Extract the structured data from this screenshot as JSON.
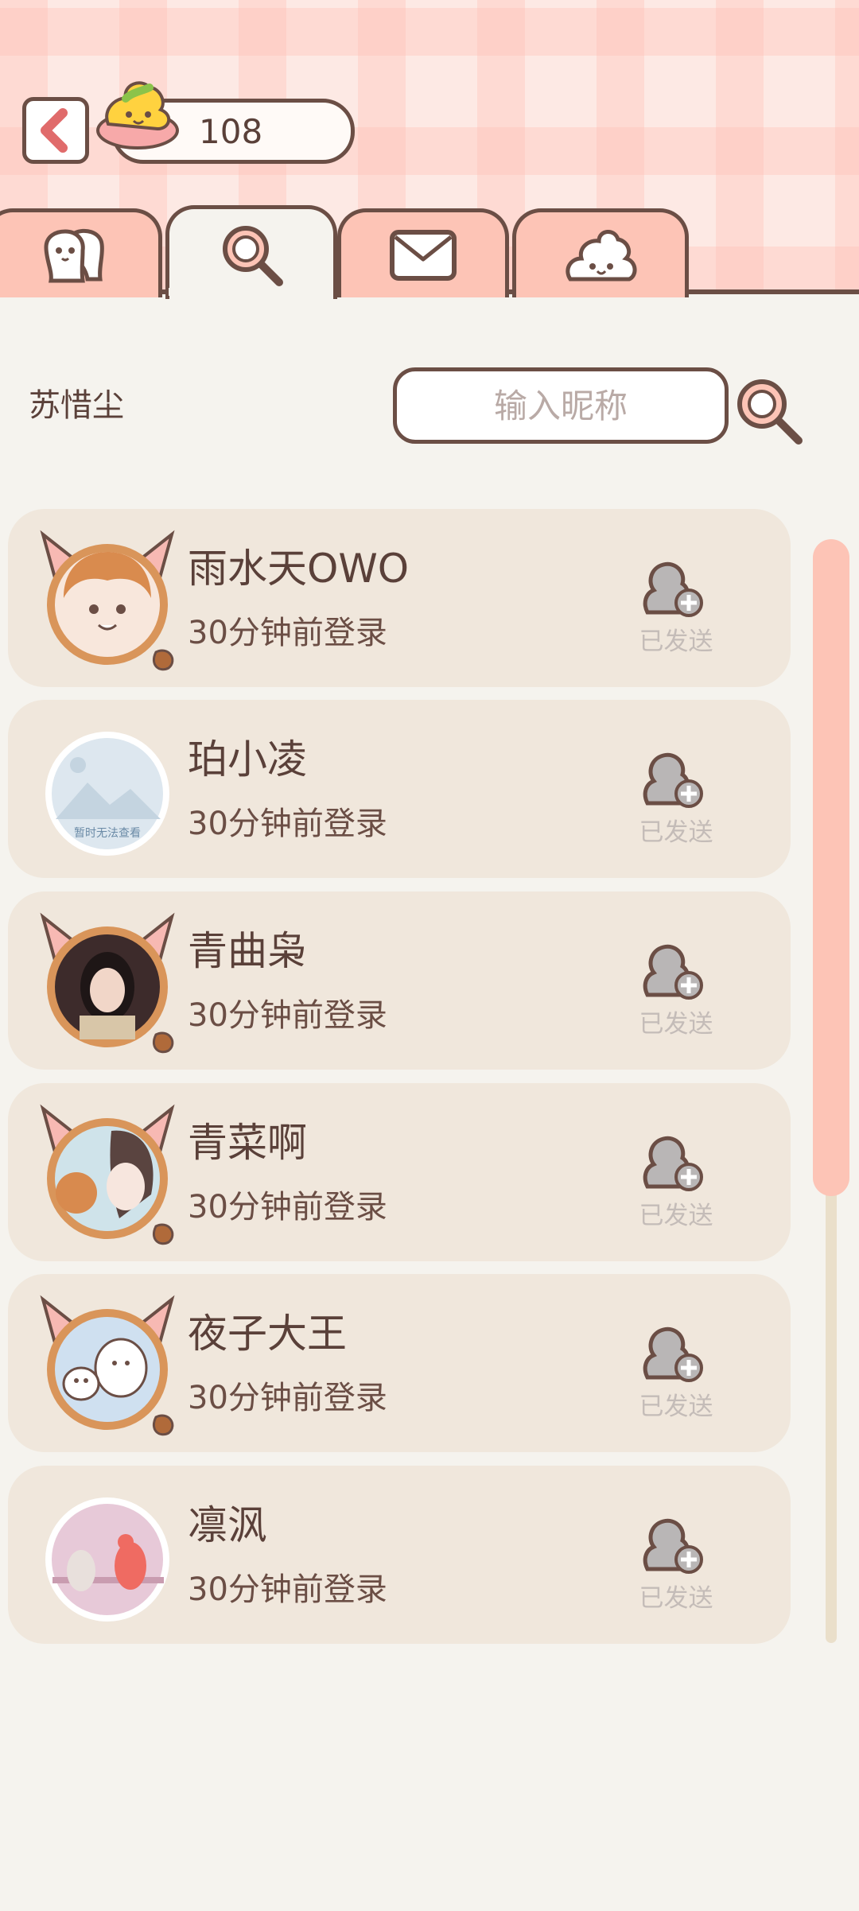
{
  "header": {
    "coin_count": "108",
    "tabs": [
      {
        "icon": "friends-icon",
        "active": false
      },
      {
        "icon": "search-icon",
        "active": true
      },
      {
        "icon": "mail-icon",
        "active": false
      },
      {
        "icon": "poop-icon",
        "active": false
      }
    ]
  },
  "search": {
    "my_name": "苏惜尘",
    "placeholder": "输入昵称"
  },
  "users": [
    {
      "name": "雨水天OWO",
      "status": "30分钟前登录",
      "action": "已发送",
      "avatar_frame": "cat-ears"
    },
    {
      "name": "珀小凌",
      "status": "30分钟前登录",
      "action": "已发送",
      "avatar_frame": "plain",
      "avatar_caption": "暂时无法查看"
    },
    {
      "name": "青曲枭",
      "status": "30分钟前登录",
      "action": "已发送",
      "avatar_frame": "cat-ears"
    },
    {
      "name": "青菜啊",
      "status": "30分钟前登录",
      "action": "已发送",
      "avatar_frame": "cat-ears"
    },
    {
      "name": "夜子大王",
      "status": "30分钟前登录",
      "action": "已发送",
      "avatar_frame": "cat-ears"
    },
    {
      "name": "凛沨",
      "status": "30分钟前登录",
      "action": "已发送",
      "avatar_frame": "plain"
    }
  ],
  "colors": {
    "accent": "#fdc4b6",
    "outline": "#6b4e45",
    "card": "#f0e7dc",
    "background": "#f5f3ee"
  }
}
